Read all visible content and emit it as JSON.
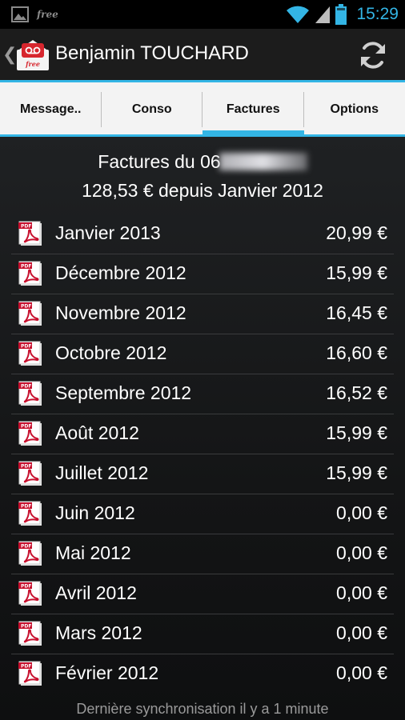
{
  "status_bar": {
    "carrier_label": "free",
    "time": "15:29",
    "colors": {
      "accent": "#33b5e5"
    },
    "icons": [
      "gallery-notification-icon",
      "wifi-icon",
      "signal-icon",
      "battery-icon"
    ]
  },
  "action_bar": {
    "title": "Benjamin TOUCHARD",
    "logo_text": "free",
    "icons": [
      "back-chevron-icon",
      "free-voicemail-logo-icon",
      "refresh-icon"
    ]
  },
  "tabs": [
    {
      "label": "Message..",
      "active": false
    },
    {
      "label": "Conso",
      "active": false
    },
    {
      "label": "Factures",
      "active": true
    },
    {
      "label": "Options",
      "active": false
    }
  ],
  "header": {
    "line1_prefix": "Factures du 06",
    "line2": "128,53 € depuis Janvier 2012"
  },
  "invoices": [
    {
      "month": "Janvier 2013",
      "amount": "20,99 €"
    },
    {
      "month": "Décembre 2012",
      "amount": "15,99 €"
    },
    {
      "month": "Novembre 2012",
      "amount": "16,45 €"
    },
    {
      "month": "Octobre 2012",
      "amount": "16,60 €"
    },
    {
      "month": "Septembre 2012",
      "amount": "16,52 €"
    },
    {
      "month": "Août 2012",
      "amount": "15,99 €"
    },
    {
      "month": "Juillet 2012",
      "amount": "15,99 €"
    },
    {
      "month": "Juin 2012",
      "amount": "0,00 €"
    },
    {
      "month": "Mai 2012",
      "amount": "0,00 €"
    },
    {
      "month": "Avril 2012",
      "amount": "0,00 €"
    },
    {
      "month": "Mars 2012",
      "amount": "0,00 €"
    },
    {
      "month": "Février 2012",
      "amount": "0,00 €"
    }
  ],
  "pdf_icon_label": "PDF",
  "footer": "Dernière synchronisation il y a 1 minute"
}
